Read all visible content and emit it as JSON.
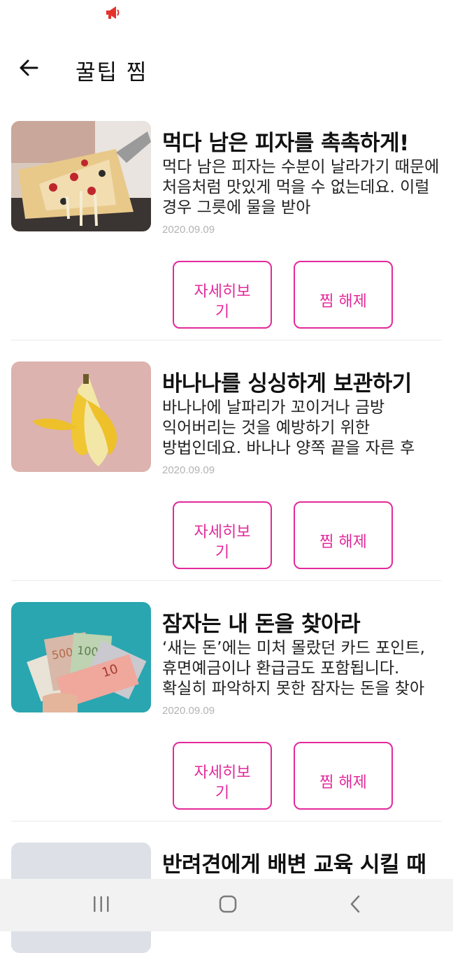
{
  "status_bar": {
    "notification_icon": "megaphone-icon",
    "icon_color": "#e5322d"
  },
  "header": {
    "title": "꿀팁 찜",
    "back_icon": "arrow-left-icon"
  },
  "accent_color": "#e3299b",
  "cards": [
    {
      "image": "pizza-photo",
      "title": "먹다 남은 피자를 촉촉하게!",
      "description": "먹다 남은 피자는 수분이 날라가기 때문에 처음처럼 맛있게 먹을 수 없는데요. 이럴 경우 그릇에 물을 받아",
      "date": "2020.09.09",
      "detail_button": "자세히보기",
      "unfav_button": "찜 해제"
    },
    {
      "image": "banana-photo",
      "title": "바나나를 싱싱하게 보관하기",
      "description": "바나나에 날파리가 꼬이거나 금방 익어버리는 것을 예방하기 위한 방법인데요. 바나나 양쪽 끝을 자른 후",
      "date": "2020.09.09",
      "detail_button": "자세히보기",
      "unfav_button": "찜 해제"
    },
    {
      "image": "money-photo",
      "title": "잠자는 내 돈을 찾아라",
      "description": "‘새는 돈’에는 미처 몰랐던 카드 포인트, 휴면예금이나 환급금도 포함됩니다. 확실히 파악하지 못한 잠자는 돈을 찾아",
      "date": "2020.09.09",
      "detail_button": "자세히보기",
      "unfav_button": "찜 해제"
    },
    {
      "image": "dog-photo",
      "title": "반려견에게 배변 교육 시킬 때"
    }
  ],
  "nav_bar": {
    "recent_icon": "recent-apps-icon",
    "home_icon": "home-icon",
    "back_icon": "back-chevron-icon"
  }
}
